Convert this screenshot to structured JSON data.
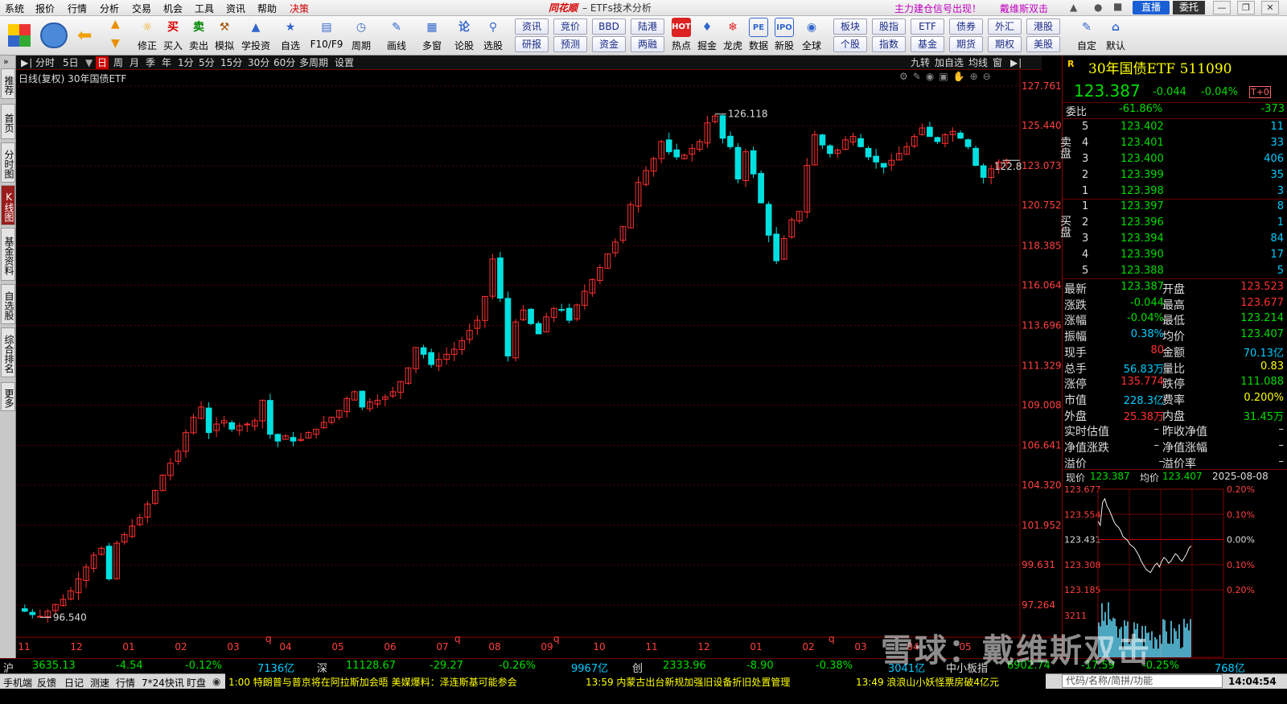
{
  "menu": [
    "系统",
    "报价",
    "行情",
    "分析",
    "交易",
    "机会",
    "工具",
    "资讯",
    "帮助",
    "决策"
  ],
  "window": {
    "brand": "同花顺",
    "title": "– ETFs技术分析",
    "ad1": "主力建仓信号出现！",
    "ad2": "戴维斯双击",
    "live": "直播",
    "commission": "委托"
  },
  "toolbar": {
    "buttons": [
      "修正",
      "买入",
      "卖出",
      "模拟",
      "学投资",
      "自选",
      "F10/F9",
      "周期",
      "画线",
      "多窗",
      "论股",
      "选股"
    ],
    "grid1": [
      "资讯",
      "竞价",
      "BBD",
      "陆港",
      "研报",
      "预测",
      "资金",
      "两融"
    ],
    "buttons2": [
      "热点",
      "掘金",
      "龙虎",
      "数据",
      "新股",
      "全球"
    ],
    "grid2": [
      "板块",
      "股指",
      "ETF",
      "债券",
      "外汇",
      "港股",
      "个股",
      "指数",
      "基金",
      "期货",
      "期权",
      "美股"
    ],
    "buttons3": [
      "自定",
      "默认"
    ]
  },
  "left_tabs": [
    "推荐",
    "首页",
    "分时图",
    "K线图",
    "基金资料",
    "自选股",
    "综合排名",
    "更多"
  ],
  "chart_tabs": [
    "分时",
    "5日",
    "日",
    "周",
    "月",
    "季",
    "年",
    "1分",
    "5分",
    "15分",
    "30分",
    "60分",
    "多周期",
    "设置"
  ],
  "chart_tabs_right": [
    "九转",
    "加自选",
    "均线",
    "窗"
  ],
  "chart": {
    "title": "日线(复权)  30年国债ETF",
    "y_ticks": [
      "127.761",
      "125.440",
      "123.073",
      "120.752",
      "118.385",
      "116.064",
      "113.696",
      "111.329",
      "109.008",
      "106.641",
      "104.320",
      "101.952",
      "99.631",
      "97.264"
    ],
    "x_ticks": [
      "11",
      "12",
      "01",
      "02",
      "03",
      "04",
      "05",
      "06",
      "07",
      "08",
      "09",
      "10",
      "11",
      "12",
      "01",
      "02",
      "03",
      "04",
      "05"
    ],
    "high_label": "126.118",
    "low_label": "96.540",
    "last_label": "122.8",
    "colors": {
      "up": "#ff3030",
      "down": "#00e0e0",
      "grid": "#5a0000"
    }
  },
  "chart_data": {
    "type": "candlestick",
    "title": "日线(复权) 30年国债ETF",
    "ylim": [
      96.0,
      128.5
    ],
    "x_labels": [
      "11",
      "12",
      "01",
      "02",
      "03",
      "04",
      "05",
      "06",
      "07",
      "08",
      "09",
      "10",
      "11",
      "12",
      "01",
      "02",
      "03",
      "04",
      "05"
    ],
    "closes": [
      96.9,
      96.7,
      96.6,
      96.9,
      97.3,
      97.6,
      98.1,
      98.8,
      99.5,
      100.2,
      100.6,
      98.8,
      100.9,
      101.4,
      101.9,
      102.4,
      103.2,
      104.0,
      104.9,
      105.6,
      106.3,
      107.4,
      108.3,
      108.9,
      107.4,
      107.9,
      108.1,
      107.6,
      107.8,
      107.9,
      108.1,
      109.3,
      107.3,
      106.9,
      107.2,
      106.9,
      107.0,
      107.4,
      107.6,
      108.0,
      108.3,
      108.7,
      109.4,
      109.8,
      108.9,
      109.2,
      109.3,
      109.5,
      109.8,
      110.4,
      111.2,
      112.4,
      112.0,
      111.4,
      111.7,
      112.0,
      112.3,
      112.8,
      113.4,
      114.0,
      115.4,
      117.6,
      115.3,
      111.9,
      113.9,
      114.6,
      113.8,
      113.2,
      114.2,
      114.7,
      114.6,
      114.0,
      114.9,
      115.7,
      116.4,
      117.1,
      117.9,
      118.6,
      119.5,
      120.8,
      122.1,
      122.8,
      123.5,
      124.5,
      123.9,
      123.6,
      123.7,
      124.1,
      124.5,
      125.6,
      126.0,
      124.7,
      124.2,
      122.3,
      123.9,
      122.6,
      120.9,
      119.0,
      117.5,
      118.8,
      119.9,
      120.4,
      123.1,
      124.9,
      124.3,
      123.8,
      124.0,
      124.6,
      124.8,
      124.2,
      123.6,
      123.3,
      123.0,
      123.4,
      123.8,
      124.2,
      124.8,
      125.3,
      124.8,
      124.5,
      124.9,
      125.1,
      124.7,
      124.2,
      123.1,
      122.4,
      122.9,
      123.3,
      123.4
    ],
    "high": 126.118,
    "low": 96.54,
    "series": [
      {
        "name": "30年国债ETF",
        "values": "closes"
      }
    ]
  },
  "quote": {
    "name": "30年国债ETF 511090",
    "price": "123.387",
    "change": "-0.044",
    "pct": "-0.04%",
    "t0": "T+0",
    "wb_label": "委比",
    "wb_pct": "-61.86%",
    "wb_diff": "-373",
    "sell_label": "卖盘",
    "buy_label": "买盘",
    "asks": [
      {
        "lvl": "5",
        "p": "123.402",
        "v": "11"
      },
      {
        "lvl": "4",
        "p": "123.401",
        "v": "33"
      },
      {
        "lvl": "3",
        "p": "123.400",
        "v": "406"
      },
      {
        "lvl": "2",
        "p": "123.399",
        "v": "35"
      },
      {
        "lvl": "1",
        "p": "123.398",
        "v": "3"
      }
    ],
    "bids": [
      {
        "lvl": "1",
        "p": "123.397",
        "v": "8"
      },
      {
        "lvl": "2",
        "p": "123.396",
        "v": "1"
      },
      {
        "lvl": "3",
        "p": "123.394",
        "v": "84"
      },
      {
        "lvl": "4",
        "p": "123.390",
        "v": "17"
      },
      {
        "lvl": "5",
        "p": "123.388",
        "v": "5"
      }
    ],
    "stats": [
      [
        "最新",
        "123.387",
        "g",
        "开盘",
        "123.523",
        "r"
      ],
      [
        "涨跌",
        "-0.044",
        "g",
        "最高",
        "123.677",
        "r"
      ],
      [
        "涨幅",
        "-0.04%",
        "g",
        "最低",
        "123.214",
        "g"
      ],
      [
        "振幅",
        "0.38%",
        "c",
        "均价",
        "123.407",
        "g"
      ],
      [
        "现手",
        "80",
        "r",
        "金额",
        "70.13亿",
        "c"
      ],
      [
        "总手",
        "56.83万",
        "c",
        "量比",
        "0.83",
        "y"
      ],
      [
        "涨停",
        "135.774",
        "r",
        "跌停",
        "111.088",
        "g"
      ],
      [
        "市值",
        "228.3亿",
        "c",
        "费率",
        "0.200%",
        "y"
      ],
      [
        "外盘",
        "25.38万",
        "r",
        "内盘",
        "31.45万",
        "g"
      ],
      [
        "实时估值",
        "–",
        "w",
        "昨收净值",
        "–",
        "w"
      ],
      [
        "净值涨跌",
        "–",
        "w",
        "净值涨幅",
        "–",
        "w"
      ],
      [
        "溢价",
        "–",
        "w",
        "溢价率",
        "–",
        "w"
      ]
    ]
  },
  "mini": {
    "now_label": "现价",
    "now": "123.387",
    "avg_label": "均价",
    "avg": "123.407",
    "date": "2025-08-08",
    "left_ticks": [
      "123.677",
      "123.554",
      "123.431",
      "123.308",
      "123.185"
    ],
    "right_ticks": [
      "0.20%",
      "0.10%",
      "0.00%",
      "0.10%",
      "0.20%"
    ],
    "vol_tick": "3211"
  },
  "mini_chart_data": {
    "type": "line",
    "price": [
      123.52,
      123.5,
      123.62,
      123.64,
      123.6,
      123.58,
      123.55,
      123.52,
      123.5,
      123.49,
      123.47,
      123.44,
      123.43,
      123.42,
      123.4,
      123.39,
      123.38,
      123.36,
      123.34,
      123.31,
      123.29,
      123.27,
      123.26,
      123.25,
      123.27,
      123.29,
      123.3,
      123.28,
      123.31,
      123.33,
      123.32,
      123.3,
      123.31,
      123.33,
      123.35,
      123.34,
      123.32,
      123.31,
      123.33,
      123.35,
      123.38,
      123.39
    ],
    "ylim": [
      123.16,
      123.69
    ]
  },
  "index_bar": {
    "sh": [
      "沪",
      "3635.13",
      "-4.54",
      "-0.12%",
      "7136亿"
    ],
    "sz": [
      "深",
      "11128.67",
      "-29.27",
      "-0.26%",
      "9967亿"
    ],
    "cy": [
      "创",
      "2333.96",
      "-8.90",
      "-0.38%",
      "3041亿"
    ],
    "zx": [
      "中小板指",
      "6902.74",
      "-17.59",
      "-0.25%",
      "768亿"
    ]
  },
  "status": {
    "items": [
      "手机端",
      "反馈",
      "日记",
      "测速",
      "行情",
      "7*24快讯",
      "盯盘"
    ],
    "news": [
      "1:00 特朗普与普京将在阿拉斯加会晤 美媒爆料：泽连斯基可能参会",
      "13:59 内蒙古出台新规加强旧设备折旧处置管理",
      "13:49 浪浪山小妖怪票房破4亿元"
    ],
    "code_placeholder": "代码/名称/简拼/功能",
    "clock": "14:04:54"
  },
  "watermark": "雪球：戴维斯双击"
}
